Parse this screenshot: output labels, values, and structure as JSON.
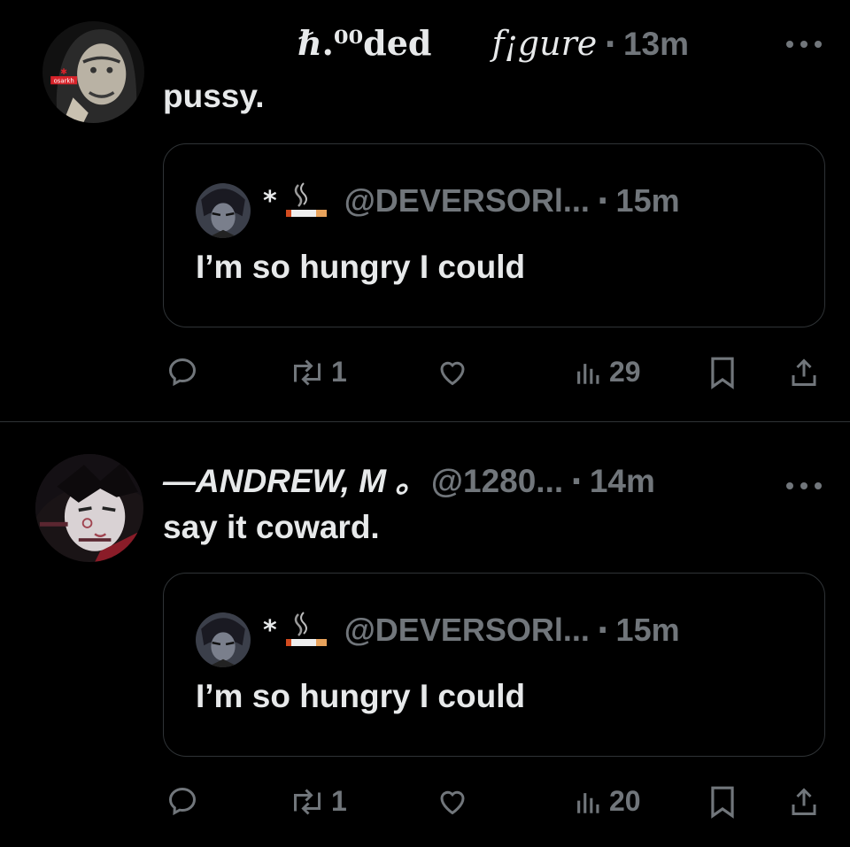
{
  "posts": [
    {
      "display_name": "ℏ.⁰⁰ded",
      "display_name_2": "f¡gure",
      "time": "13m",
      "avatar_text": "osarkh",
      "more_icon": "more-icon",
      "text": "pussy.",
      "quote": {
        "prefix": "*",
        "emoji": "🚬",
        "handle": "@DEVERSORl...",
        "time": "15m",
        "text": "I’m so hungry I could"
      },
      "actions": {
        "reply_count": "",
        "repost_count": "1",
        "like_count": "",
        "views_count": "29"
      }
    },
    {
      "display_name": "—ANDREW, M ｡",
      "handle": "@1280...",
      "time": "14m",
      "text": "say it coward.",
      "quote": {
        "prefix": "*",
        "emoji": "🚬",
        "handle": "@DEVERSORl...",
        "time": "15m",
        "text": "I’m so hungry I could"
      },
      "actions": {
        "reply_count": "",
        "repost_count": "1",
        "like_count": "",
        "views_count": "20"
      }
    }
  ],
  "colors": {
    "background": "#000000",
    "text": "#e7e9ea",
    "muted": "#71767b",
    "border": "#2f3336",
    "avatar_accent": "#d8232a"
  }
}
